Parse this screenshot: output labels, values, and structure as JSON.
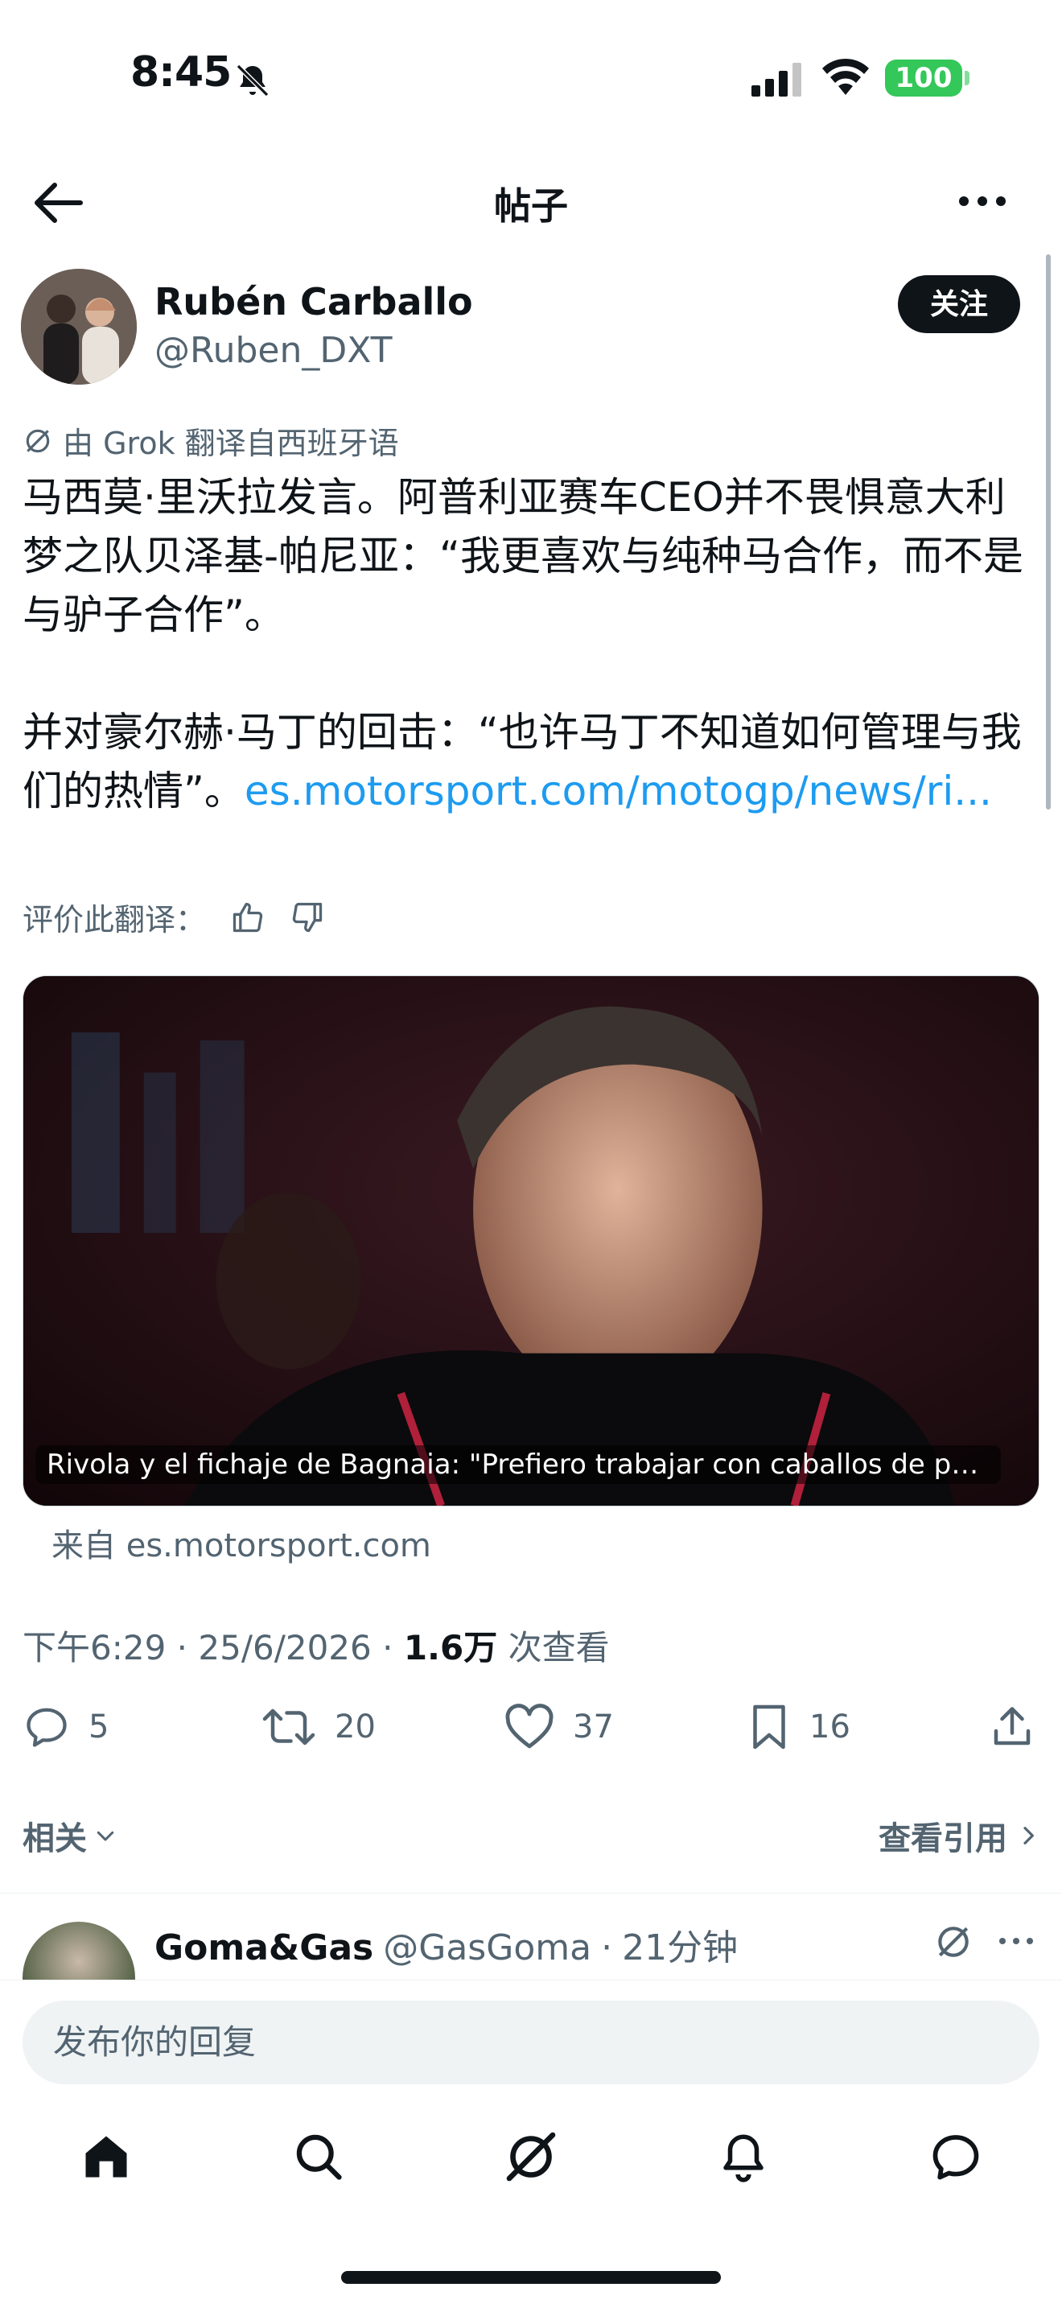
{
  "status_bar": {
    "time": "8:45",
    "battery": "100"
  },
  "header": {
    "title": "帖子"
  },
  "post": {
    "author_name": "Rubén Carballo",
    "author_handle": "@Ruben_DXT",
    "follow_label": "关注",
    "translated_label": "由 Grok 翻译自西班牙语",
    "text_para1": "马西莫·里沃拉发言。阿普利亚赛车CEO并不畏惧意大利梦之队贝泽基-帕尼亚：“我更喜欢与纯种马合作，而不是与驴子合作”。",
    "text_para2": "并对豪尔赫·马丁的回击：“也许马丁不知道如何管理与我们的热情”。",
    "link_text": "es.motorsport.com/motogp/news/ri...",
    "rate_label": "评价此翻译：",
    "card_caption": "Rivola y el fichaje de Bagnaia: \"Prefiero trabajar con caballos de pur...",
    "card_source": "来自 es.motorsport.com",
    "time": "下午6:29",
    "date": "25/6/2026",
    "views": "1.6万",
    "views_label": "次查看",
    "replies": "5",
    "reposts": "20",
    "likes": "37",
    "bookmarks": "16"
  },
  "related": {
    "label": "相关",
    "quotes_label": "查看引用"
  },
  "reply": {
    "name": "Goma&Gas",
    "handle": "@GasGoma",
    "time": "21分钟"
  },
  "composer": {
    "placeholder": "发布你的回复"
  },
  "tabs": [
    "home-icon",
    "search-icon",
    "grok-icon",
    "notifications-icon",
    "messages-icon"
  ]
}
